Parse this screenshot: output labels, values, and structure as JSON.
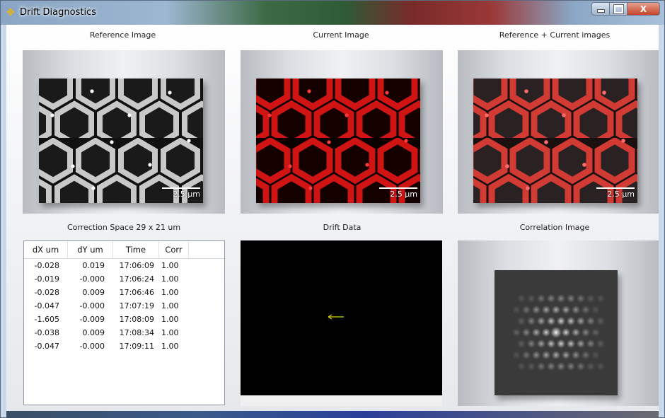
{
  "window": {
    "title": "Drift Diagnostics",
    "icon": "crosshair-icon",
    "controls": {
      "minimize": "minimize",
      "maximize": "maximize",
      "close": "X"
    }
  },
  "panels": {
    "reference": {
      "caption": "Reference Image",
      "scale": "2.5 µm"
    },
    "current": {
      "caption": "Current Image",
      "scale": "2.5 µm"
    },
    "overlay": {
      "caption": "Reference + Current images",
      "scale": "2.5 µm"
    },
    "correction": {
      "caption": "Correction Space 29 x 21 um"
    },
    "drift": {
      "caption": "Drift Data"
    },
    "correlation": {
      "caption": "Correlation Image"
    }
  },
  "table": {
    "columns": [
      "dX um",
      "dY um",
      "Time",
      "Corr"
    ],
    "rows": [
      [
        "-0.028",
        "0.019",
        "17:06:09",
        "1.00"
      ],
      [
        "-0.019",
        "-0.000",
        "17:06:24",
        "1.00"
      ],
      [
        "-0.028",
        "0.009",
        "17:06:46",
        "1.00"
      ],
      [
        "-0.047",
        "-0.000",
        "17:07:19",
        "1.00"
      ],
      [
        "-1.605",
        "-0.009",
        "17:08:09",
        "1.00"
      ],
      [
        "-0.038",
        "0.009",
        "17:08:34",
        "1.00"
      ],
      [
        "-0.047",
        "-0.000",
        "17:09:11",
        "1.00"
      ]
    ]
  },
  "colors": {
    "drift_marker": "#d8d200",
    "red_channel": "#e01818",
    "grey_channel": "#d9d9d9"
  }
}
